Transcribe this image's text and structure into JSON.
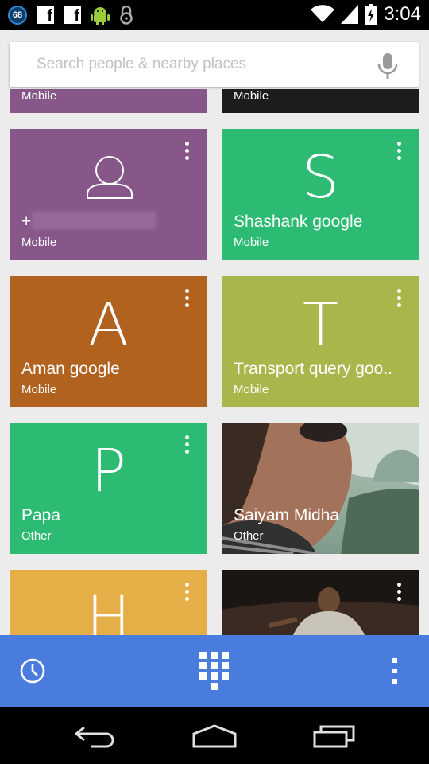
{
  "status_bar": {
    "notification_count": "68",
    "time": "3:04",
    "icons": [
      "count-badge-icon",
      "facebook-icon",
      "facebook-icon",
      "android-icon",
      "lock-icon",
      "wifi-icon",
      "signal-icon",
      "battery-charging-icon"
    ]
  },
  "search": {
    "placeholder": "Search people & nearby places"
  },
  "partial_row": {
    "left_type": "Mobile",
    "right_type": "Mobile"
  },
  "contacts": [
    {
      "name": "+",
      "type": "Mobile",
      "color": "#87578a",
      "icon": "person-icon"
    },
    {
      "name": "Shashank google",
      "type": "Mobile",
      "initial": "S",
      "color": "#2dbb73"
    },
    {
      "name": "Aman google",
      "type": "Mobile",
      "initial": "A",
      "color": "#b1621f"
    },
    {
      "name": "Transport query goo..",
      "type": "Mobile",
      "initial": "T",
      "color": "#a9b64c"
    },
    {
      "name": "Papa",
      "type": "Other",
      "initial": "P",
      "color": "#2dbb73"
    },
    {
      "name": "Saiyam Midha",
      "type": "Other",
      "photo": true
    },
    {
      "initial": "H",
      "color": "#e6ae46"
    },
    {
      "photo": true
    }
  ],
  "colors": {
    "accent": "#4a7cde"
  }
}
